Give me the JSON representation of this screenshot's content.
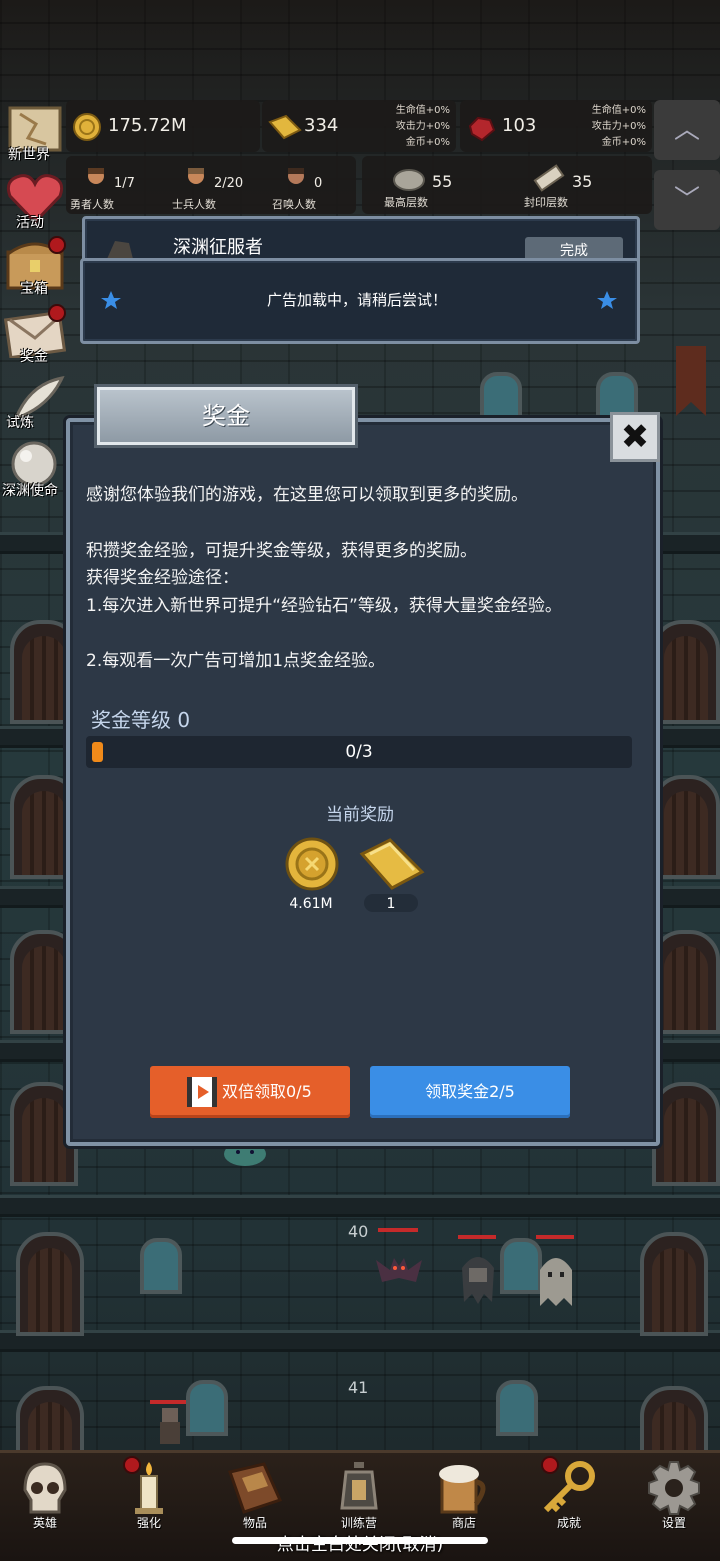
{
  "resources": {
    "gold": "175.72M",
    "gold_bar": "334",
    "gold_bar_bonus": [
      "生命值+0%",
      "攻击力+0%",
      "金币+0%"
    ],
    "ruby": "103",
    "ruby_bonus": [
      "生命值+0%",
      "攻击力+0%",
      "金币+0%"
    ]
  },
  "counts": {
    "heroes": {
      "value": "1/7",
      "label": "勇者人数"
    },
    "soldiers": {
      "value": "2/20",
      "label": "士兵人数"
    },
    "summons": {
      "value": "0",
      "label": "召唤人数"
    },
    "max_floor": {
      "value": "55",
      "label": "最高层数"
    },
    "sealed_floor": {
      "value": "35",
      "label": "封印层数"
    }
  },
  "side_menu": [
    {
      "label": "新世界",
      "icon": "map-icon"
    },
    {
      "label": "活动",
      "icon": "heart-icon"
    },
    {
      "label": "宝箱",
      "icon": "chest-icon"
    },
    {
      "label": "奖金",
      "icon": "envelope-icon"
    },
    {
      "label": "试炼",
      "icon": "quill-icon"
    },
    {
      "label": "深渊使命",
      "icon": "orb-icon"
    }
  ],
  "quest_banner": {
    "title": "深渊征服者",
    "button": "完成"
  },
  "ad_banner": {
    "text": "广告加载中，请稍后尝试！"
  },
  "dialog": {
    "title": "奖金",
    "close": "✖",
    "intro": "感谢您体验我们的游戏，在这里您可以领取到更多的奖励。",
    "lines": [
      "积攒奖金经验，可提升奖金等级，获得更多的奖励。",
      "获得奖金经验途径：",
      "1.每次进入新世界可提升“经验钻石”等级，获得大量奖金经验。",
      "2.每观看一次广告可增加1点奖金经验。"
    ],
    "level_label": "奖金等级 0",
    "progress_text": "0/3",
    "progress_fraction": 0.02,
    "reward_title": "当前奖励",
    "rewards": [
      {
        "icon": "gold-coin-icon",
        "value": "4.61M"
      },
      {
        "icon": "gold-bar-icon",
        "value": "1"
      }
    ],
    "double_button": "双倍领取0/5",
    "claim_button": "领取奖金2/5"
  },
  "floors": {
    "upper": "40",
    "lower": "41"
  },
  "bottom_nav": [
    {
      "label": "英雄",
      "icon": "skull-icon"
    },
    {
      "label": "强化",
      "icon": "candle-icon"
    },
    {
      "label": "物品",
      "icon": "book-icon"
    },
    {
      "label": "训练营",
      "icon": "lantern-icon"
    },
    {
      "label": "商店",
      "icon": "mug-icon"
    },
    {
      "label": "成就",
      "icon": "key-icon"
    },
    {
      "label": "设置",
      "icon": "gear-icon"
    }
  ],
  "footer_tip": "点击空白处关闭(取消)"
}
